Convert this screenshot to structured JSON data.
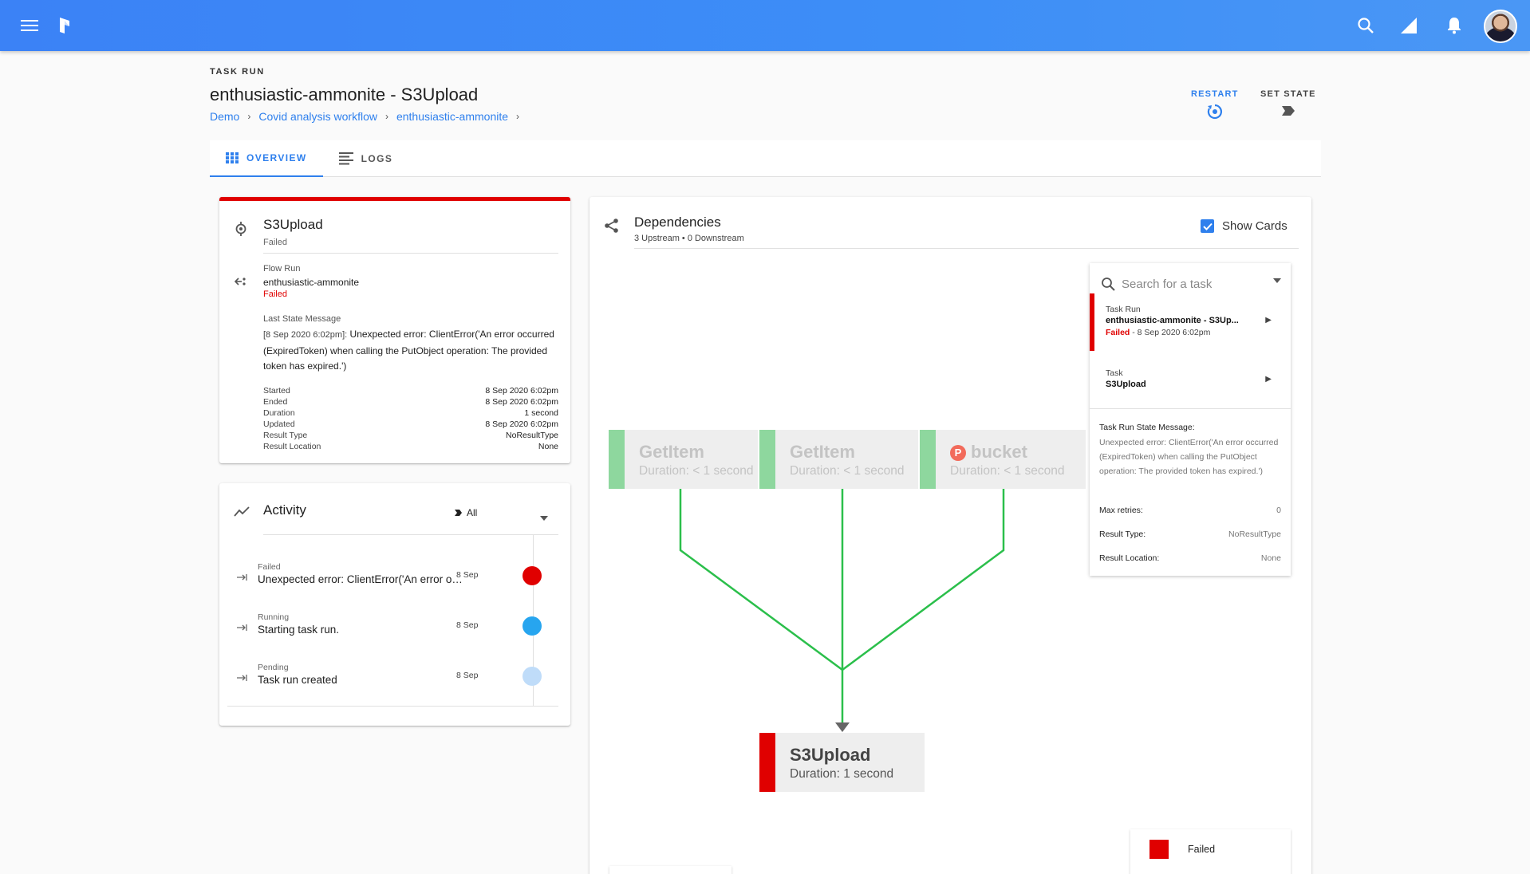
{
  "header": {
    "eyebrow": "TASK RUN",
    "title": "enthusiastic-ammonite - S3Upload",
    "breadcrumbs": [
      "Demo",
      "Covid analysis workflow",
      "enthusiastic-ammonite"
    ],
    "actions": {
      "restart": "RESTART",
      "set_state": "SET STATE"
    },
    "icons": [
      "menu-icon",
      "prefect-logo",
      "search-icon",
      "signal-icon",
      "bell-icon"
    ]
  },
  "tabs": [
    {
      "label": "OVERVIEW",
      "icon": "grid-icon",
      "active": true
    },
    {
      "label": "LOGS",
      "icon": "logs-icon",
      "active": false
    }
  ],
  "summary": {
    "name": "S3Upload",
    "state": "Failed",
    "flow_run_label": "Flow Run",
    "flow_run_name": "enthusiastic-ammonite",
    "flow_run_state": "Failed",
    "last_state_label": "Last State Message",
    "last_state_time": "[8 Sep 2020 6:02pm]:",
    "last_state_message": "Unexpected error: ClientError('An error occurred (ExpiredToken) when calling the PutObject operation: The provided token has expired.')",
    "meta": [
      {
        "k": "Started",
        "v": "8 Sep 2020 6:02pm"
      },
      {
        "k": "Ended",
        "v": "8 Sep 2020 6:02pm"
      },
      {
        "k": "Duration",
        "v": "1 second"
      },
      {
        "k": "Updated",
        "v": "8 Sep 2020 6:02pm"
      },
      {
        "k": "Result Type",
        "v": "NoResultType"
      },
      {
        "k": "Result Location",
        "v": "None"
      }
    ]
  },
  "activity": {
    "title": "Activity",
    "filter": "All",
    "items": [
      {
        "state": "Failed",
        "text": "Unexpected error: ClientError('An error occurred (ExpiredToken) when calling the PutObject operation",
        "date": "8 Sep",
        "color": "#e00000"
      },
      {
        "state": "Running",
        "text": "Starting task run.",
        "date": "8 Sep",
        "color": "#27a5ef"
      },
      {
        "state": "Pending",
        "text": "Task run created",
        "date": "8 Sep",
        "color": "#bfdcf9"
      }
    ]
  },
  "dependencies": {
    "title": "Dependencies",
    "subtitle": "3 Upstream • 0 Downstream",
    "show_cards_label": "Show Cards",
    "show_cards": true,
    "nodes": {
      "up1": {
        "name": "GetItem",
        "duration": "Duration: < 1 second"
      },
      "up2": {
        "name": "GetItem",
        "duration": "Duration: < 1 second"
      },
      "up3": {
        "name": "bucket",
        "badge": "P",
        "duration": "Duration: < 1 second"
      },
      "main": {
        "name": "S3Upload",
        "duration": "Duration: 1 second"
      }
    },
    "colors": {
      "success": "#2bbf4b",
      "failed": "#e00000",
      "faded_bar": "#8ed79e"
    }
  },
  "side_panel": {
    "search_placeholder": "Search for a task",
    "task_run_label": "Task Run",
    "task_run_name": "enthusiastic-ammonite - S3Up...",
    "task_run_state": "Failed",
    "task_run_time": " - 8 Sep 2020 6:02pm",
    "task_label": "Task",
    "task_name": "S3Upload",
    "state_msg_label": "Task Run State Message:",
    "state_msg": "Unexpected error: ClientError('An error occurred (ExpiredToken) when calling the PutObject operation: The provided token has expired.')",
    "max_retries_label": "Max retries:",
    "max_retries": "0",
    "result_type_label": "Result Type:",
    "result_type": "NoResultType",
    "result_location_label": "Result Location:",
    "result_location": "None"
  },
  "legend": {
    "label": "Failed",
    "color": "#e00000"
  }
}
